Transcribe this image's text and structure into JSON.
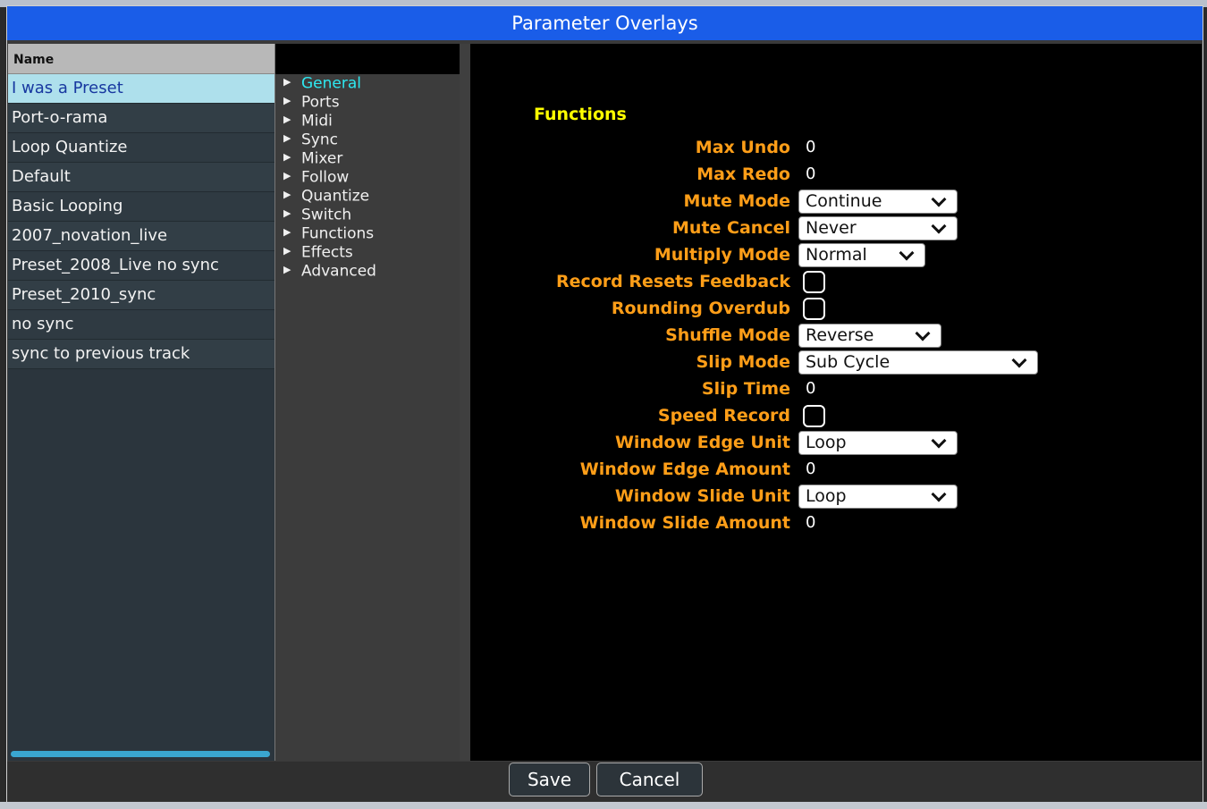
{
  "window": {
    "title": "Parameter Overlays"
  },
  "presets": {
    "column_header": "Name",
    "items": [
      "I was a Preset",
      "Port-o-rama",
      "Loop Quantize",
      "Default",
      "Basic Looping",
      "2007_novation_live",
      "Preset_2008_Live no sync",
      "Preset_2010_sync",
      "no sync",
      "sync to previous track"
    ],
    "selected": "I was a Preset"
  },
  "tree": {
    "items": [
      "General",
      "Ports",
      "Midi",
      "Sync",
      "Mixer",
      "Follow",
      "Quantize",
      "Switch",
      "Functions",
      "Effects",
      "Advanced"
    ],
    "active": "General",
    "arrow": "▶"
  },
  "form": {
    "section_title": "Functions",
    "fields": [
      {
        "label": "Max Undo",
        "type": "text",
        "value": "0"
      },
      {
        "label": "Max Redo",
        "type": "text",
        "value": "0"
      },
      {
        "label": "Mute Mode",
        "type": "select",
        "value": "Continue"
      },
      {
        "label": "Mute Cancel",
        "type": "select",
        "value": "Never"
      },
      {
        "label": "Multiply Mode",
        "type": "select",
        "value": "Normal"
      },
      {
        "label": "Record Resets Feedback",
        "type": "checkbox",
        "checked": false
      },
      {
        "label": "Rounding Overdub",
        "type": "checkbox",
        "checked": false
      },
      {
        "label": "Shuffle Mode",
        "type": "select",
        "value": "Reverse"
      },
      {
        "label": "Slip Mode",
        "type": "select",
        "value": "Sub Cycle"
      },
      {
        "label": "Slip Time",
        "type": "text",
        "value": "0"
      },
      {
        "label": "Speed Record",
        "type": "checkbox",
        "checked": false
      },
      {
        "label": "Window Edge Unit",
        "type": "select",
        "value": "Loop"
      },
      {
        "label": "Window Edge Amount",
        "type": "text",
        "value": "0"
      },
      {
        "label": "Window Slide Unit",
        "type": "select",
        "value": "Loop"
      },
      {
        "label": "Window Slide Amount",
        "type": "text",
        "value": "0"
      }
    ]
  },
  "footer": {
    "save_label": "Save",
    "cancel_label": "Cancel"
  },
  "colors": {
    "title_bar": "#1a5de8",
    "field_label": "#ff9e18",
    "section_title": "#ffff00",
    "active_tree_item": "#2ee8f0",
    "selected_preset_bg": "#aee0ec"
  }
}
